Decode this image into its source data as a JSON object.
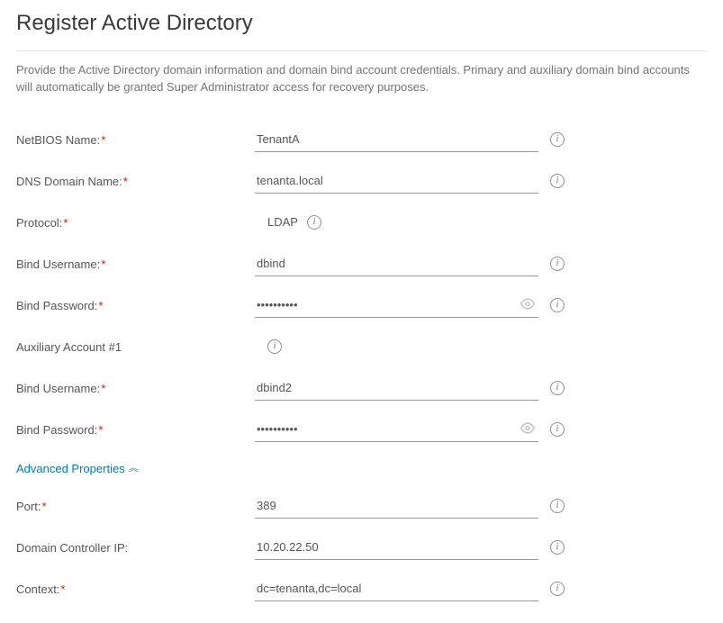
{
  "title": "Register Active Directory",
  "description": "Provide the Active Directory domain information and domain bind account credentials. Primary and auxiliary domain bind accounts will automatically be granted Super Administrator access for recovery purposes.",
  "labels": {
    "netbios_name": "NetBIOS Name:",
    "dns_domain_name": "DNS Domain Name:",
    "protocol": "Protocol:",
    "bind_username": "Bind Username:",
    "bind_password": "Bind Password:",
    "auxiliary_account_1": "Auxiliary Account #1",
    "bind_username_2": "Bind Username:",
    "bind_password_2": "Bind Password:",
    "advanced_properties": "Advanced Properties",
    "port": "Port:",
    "domain_controller_ip": "Domain Controller IP:",
    "context": "Context:"
  },
  "values": {
    "netbios_name": "TenantA",
    "dns_domain_name": "tenanta.local",
    "protocol": "LDAP",
    "bind_username": "dbind",
    "bind_password": "••••••••••",
    "bind_username_2": "dbind2",
    "bind_password_2": "••••••••••",
    "port": "389",
    "domain_controller_ip": "10.20.22.50",
    "context": "dc=tenanta,dc=local"
  },
  "required_asterisk": "*",
  "caret_up": "︽"
}
